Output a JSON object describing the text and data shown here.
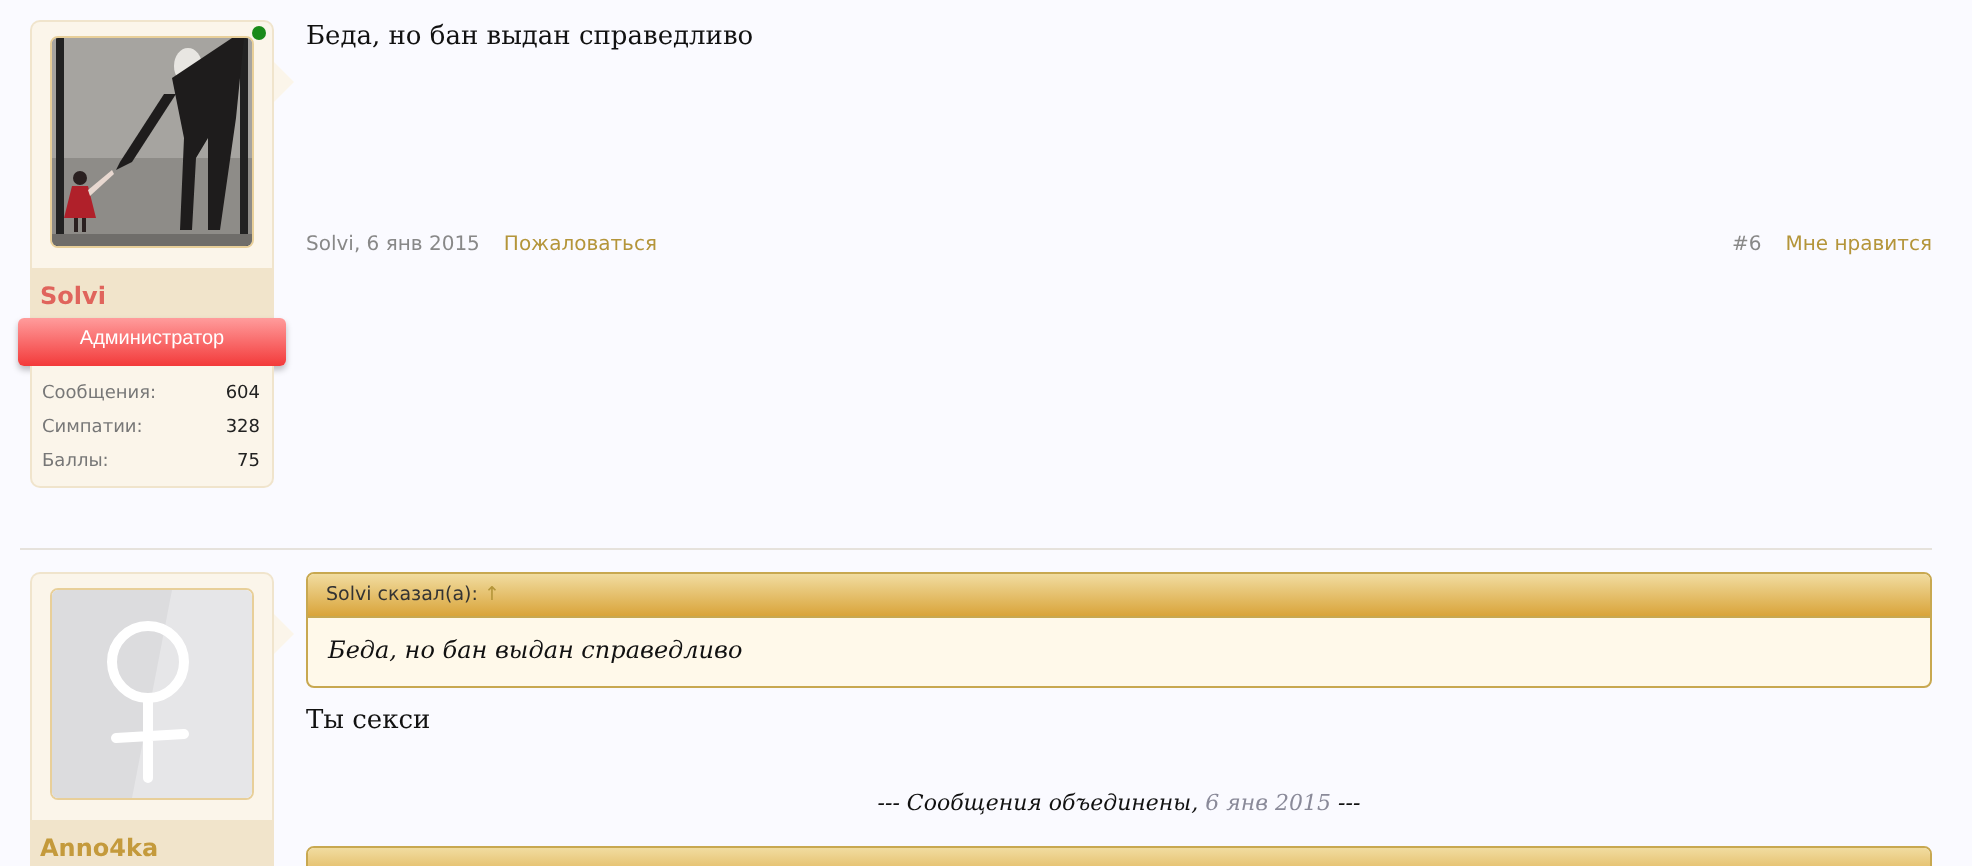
{
  "posts": [
    {
      "user": {
        "name": "Solvi",
        "color": "#e0645c",
        "online": true,
        "title": "Администратор",
        "stats": [
          {
            "label": "Сообщения:",
            "value": "604"
          },
          {
            "label": "Симпатии:",
            "value": "328"
          },
          {
            "label": "Баллы:",
            "value": "75"
          }
        ]
      },
      "body": [
        {
          "kind": "text",
          "text": "Беда, но бан выдан справедливо"
        }
      ],
      "footer": {
        "byline": "Solvi, 6 янв 2015",
        "report": "Пожаловаться",
        "number": "#6",
        "like": "Мне нравится"
      }
    },
    {
      "user": {
        "name": "Anno4ka",
        "color": "#c49a3c",
        "avatar": {
          "kind": "default"
        }
      },
      "body": [
        {
          "kind": "quote",
          "author": "Solvi сказал(а):",
          "arrow": "↑",
          "text": "Беда, но бан выдан справедливо"
        },
        {
          "kind": "text",
          "text": "Ты секси"
        },
        {
          "kind": "merged",
          "lead": "--- Сообщения объединены,",
          "date": "6 янв 2015",
          "tail": "---"
        },
        {
          "kind": "quote"
        }
      ]
    }
  ]
}
